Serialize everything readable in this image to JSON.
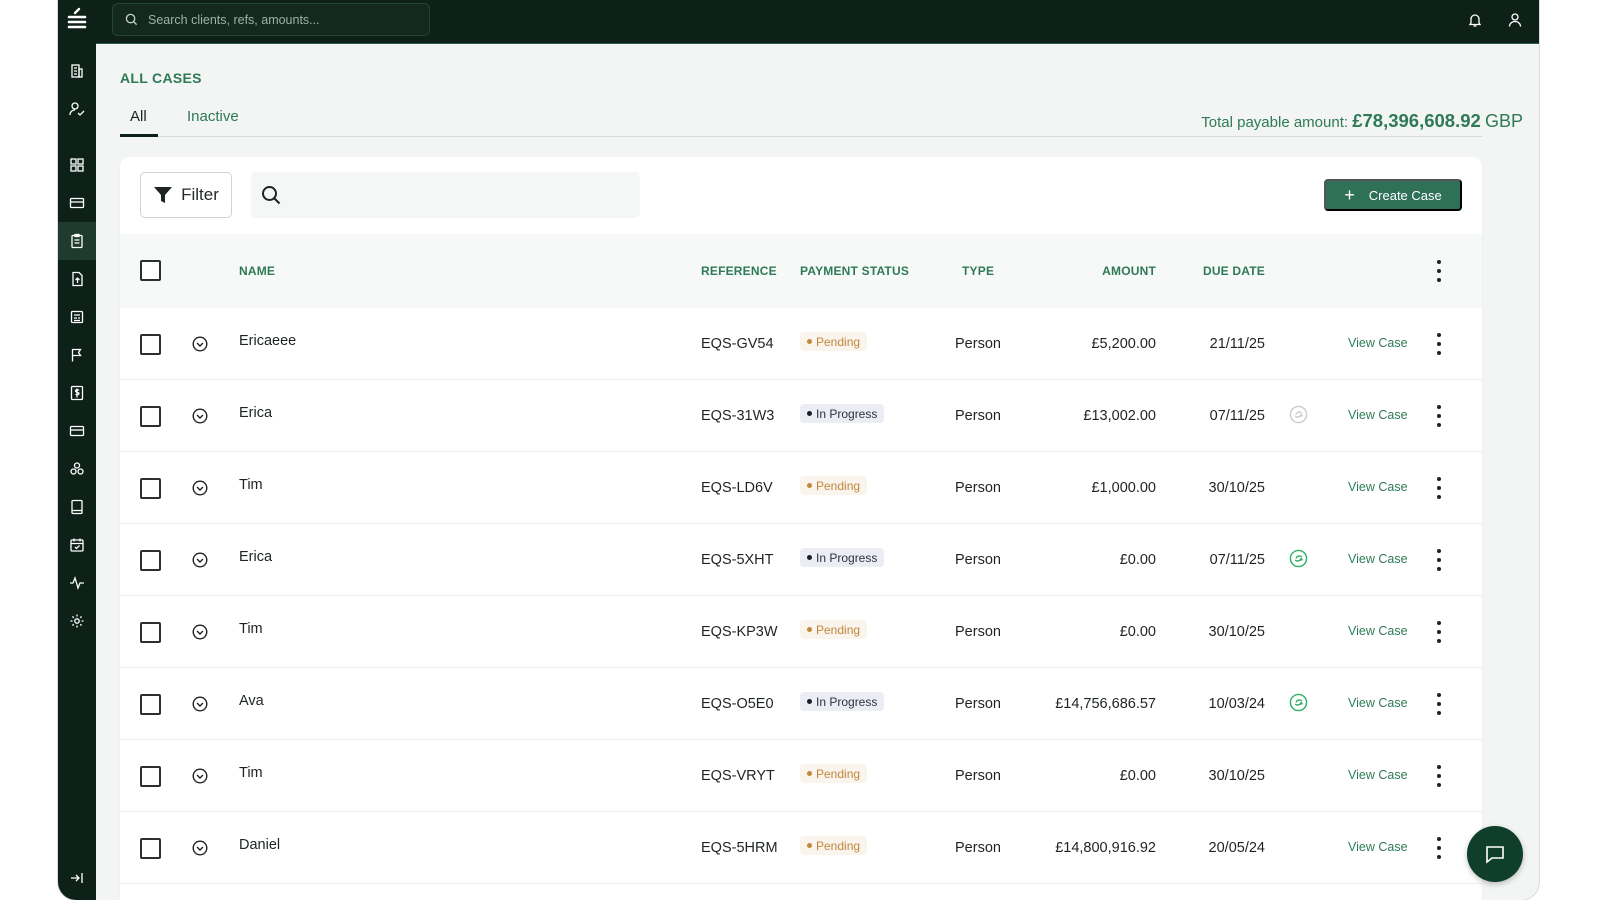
{
  "header": {
    "search_placeholder": "Search clients, refs, amounts..."
  },
  "page": {
    "title": "ALL CASES",
    "tabs": [
      {
        "label": "All",
        "active": true
      },
      {
        "label": "Inactive",
        "active": false
      }
    ],
    "total_label": "Total payable amount:",
    "total_amount": "£78,396,608.92",
    "total_currency": "GBP"
  },
  "toolbar": {
    "filter_label": "Filter",
    "search_placeholder": "",
    "create_label": "Create Case"
  },
  "table": {
    "columns": {
      "name": "NAME",
      "reference": "REFERENCE",
      "payment_status": "PAYMENT STATUS",
      "type": "TYPE",
      "amount": "AMOUNT",
      "due_date": "DUE DATE"
    },
    "view_label": "View Case",
    "rows": [
      {
        "name": "Ericaeee",
        "reference": "EQS-GV54",
        "status": "Pending",
        "type": "Person",
        "amount": "£5,200.00",
        "due": "21/11/25",
        "mark": "none"
      },
      {
        "name": "Erica",
        "reference": "EQS-31W3",
        "status": "In Progress",
        "type": "Person",
        "amount": "£13,002.00",
        "due": "07/11/25",
        "mark": "faded"
      },
      {
        "name": "Tim",
        "reference": "EQS-LD6V",
        "status": "Pending",
        "type": "Person",
        "amount": "£1,000.00",
        "due": "30/10/25",
        "mark": "none"
      },
      {
        "name": "Erica",
        "reference": "EQS-5XHT",
        "status": "In Progress",
        "type": "Person",
        "amount": "£0.00",
        "due": "07/11/25",
        "mark": "green"
      },
      {
        "name": "Tim",
        "reference": "EQS-KP3W",
        "status": "Pending",
        "type": "Person",
        "amount": "£0.00",
        "due": "30/10/25",
        "mark": "none"
      },
      {
        "name": "Ava",
        "reference": "EQS-O5E0",
        "status": "In Progress",
        "type": "Person",
        "amount": "£14,756,686.57",
        "due": "10/03/24",
        "mark": "green"
      },
      {
        "name": "Tim",
        "reference": "EQS-VRYT",
        "status": "Pending",
        "type": "Person",
        "amount": "£0.00",
        "due": "30/10/25",
        "mark": "none"
      },
      {
        "name": "Daniel",
        "reference": "EQS-5HRM",
        "status": "Pending",
        "type": "Person",
        "amount": "£14,800,916.92",
        "due": "20/05/24",
        "mark": "none"
      }
    ]
  },
  "colors": {
    "sidebar_bg": "#0e2119",
    "accent_green": "#2e7a57",
    "button_green": "#2e7058",
    "pending": "#c0883b",
    "progress": "#2d3240"
  },
  "sidebar_icons": [
    "buildings-icon",
    "user-check-icon",
    "dashboard-icon",
    "card-icon",
    "clipboard-icon",
    "file-upload-icon",
    "report-icon",
    "flag-icon",
    "dollar-icon",
    "credit-card-icon",
    "network-icon",
    "book-icon",
    "calendar-check-icon",
    "activity-icon",
    "settings-icon",
    "collapse-icon"
  ]
}
